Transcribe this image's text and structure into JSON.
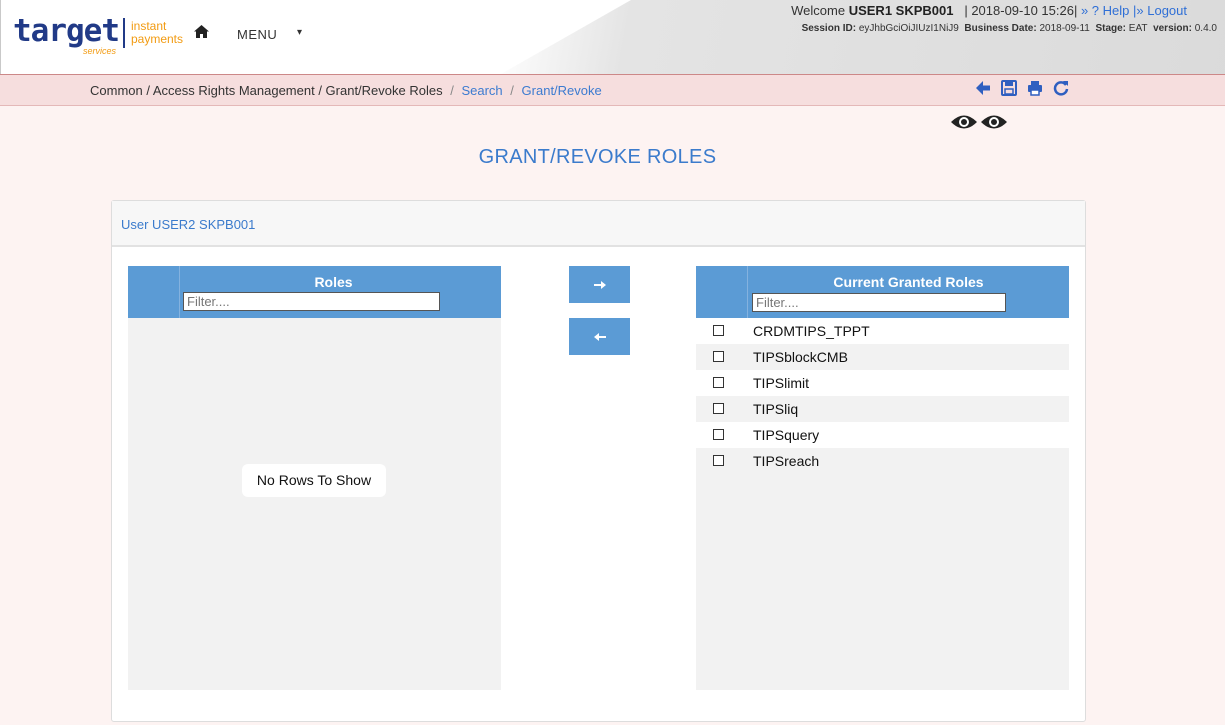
{
  "header": {
    "logo": {
      "word": "target",
      "services": "services",
      "line1": "instant",
      "line2": "payments"
    },
    "menu_label": "MENU",
    "welcome_prefix": "Welcome",
    "user": "USER1 SKPB001",
    "datetime": "| 2018-09-10 15:26|",
    "help_label": "» ? Help",
    "logout_label": "|» Logout",
    "session_label": "Session ID:",
    "session_id": "eyJhbGciOiJIUzI1NiJ9",
    "business_date_label": "Business Date:",
    "business_date": "2018-09-11",
    "stage_label": "Stage:",
    "stage": "EAT",
    "version_label": "version:",
    "version": "0.4.0"
  },
  "breadcrumb": {
    "path": "Common / Access Rights Management / Grant/Revoke Roles",
    "sep": "/",
    "search": "Search",
    "current": "Grant/Revoke"
  },
  "page_title": "GRANT/REVOKE ROLES",
  "panel": {
    "user_heading": "User USER2 SKPB001",
    "available": {
      "title": "Roles",
      "filter_placeholder": "Filter....",
      "empty_text": "No Rows To Show"
    },
    "granted": {
      "title": "Current Granted Roles",
      "filter_placeholder": "Filter....",
      "rows": [
        "CRDMTIPS_TPPT",
        "TIPSblockCMB",
        "TIPSlimit",
        "TIPSliq",
        "TIPSquery",
        "TIPSreach"
      ]
    },
    "grant_button": "→",
    "revoke_button": "←"
  },
  "colors": {
    "brand_blue": "#213a87",
    "accent_orange": "#f29b12",
    "grid_header": "#5b9bd5",
    "title_blue": "#3b7bcc",
    "breadcrumb_bg": "#f6dede"
  },
  "icons": [
    "home-icon",
    "chevron-down-icon",
    "back-icon",
    "save-icon",
    "print-icon",
    "refresh-icon",
    "eye-icon",
    "arrow-right-icon",
    "arrow-left-icon"
  ]
}
